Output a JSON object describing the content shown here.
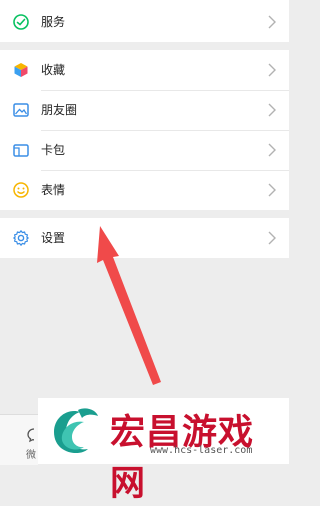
{
  "menu": {
    "services": {
      "label": "服务",
      "icon": "services-icon"
    },
    "items": [
      {
        "label": "收藏",
        "icon": "favorites-icon"
      },
      {
        "label": "朋友圈",
        "icon": "moments-icon"
      },
      {
        "label": "卡包",
        "icon": "card-pack-icon"
      },
      {
        "label": "表情",
        "icon": "sticker-icon"
      }
    ],
    "settings": {
      "label": "设置",
      "icon": "gear-icon"
    }
  },
  "tabbar": {
    "partial_label": "微"
  },
  "watermark": {
    "title": "宏昌游戏网",
    "url": "www.hcs-laser.com"
  },
  "colors": {
    "background": "#ededed",
    "accent_arrow": "#f04a4a",
    "watermark_red": "#c8102e",
    "services_green": "#07c160"
  }
}
